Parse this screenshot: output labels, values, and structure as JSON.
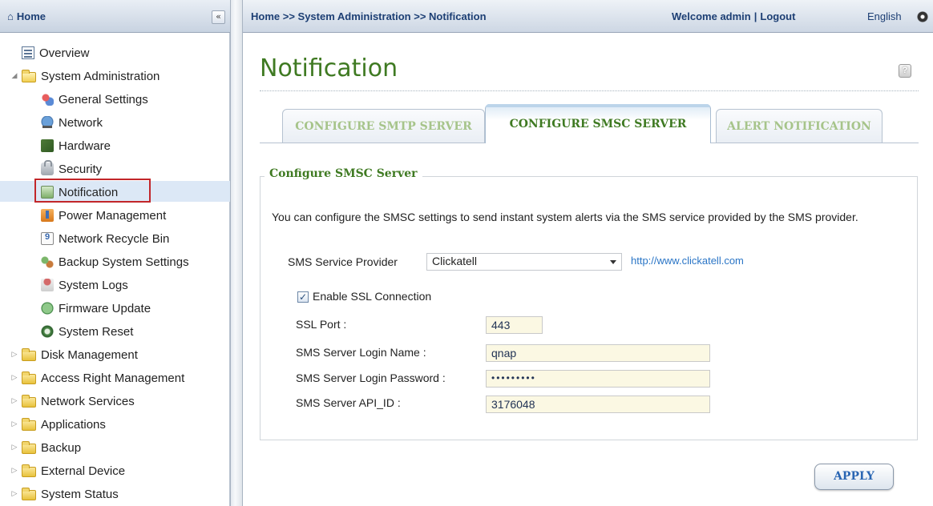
{
  "sidebar": {
    "title": "Home",
    "collapse_label": "«",
    "items": [
      {
        "label": "Overview"
      },
      {
        "label": "System Administration"
      },
      {
        "label": "General Settings"
      },
      {
        "label": "Network"
      },
      {
        "label": "Hardware"
      },
      {
        "label": "Security"
      },
      {
        "label": "Notification"
      },
      {
        "label": "Power Management"
      },
      {
        "label": "Network Recycle Bin"
      },
      {
        "label": "Backup System Settings"
      },
      {
        "label": "System Logs"
      },
      {
        "label": "Firmware Update"
      },
      {
        "label": "System Reset"
      },
      {
        "label": "Disk Management"
      },
      {
        "label": "Access Right Management"
      },
      {
        "label": "Network Services"
      },
      {
        "label": "Applications"
      },
      {
        "label": "Backup"
      },
      {
        "label": "External Device"
      },
      {
        "label": "System Status"
      }
    ]
  },
  "header": {
    "breadcrumb": "Home >> System Administration >> Notification",
    "welcome": "Welcome admin",
    "separator": "|",
    "logout": "Logout",
    "language": "English"
  },
  "page": {
    "title": "Notification",
    "help": "?"
  },
  "tabs": [
    {
      "label": "CONFIGURE SMTP SERVER"
    },
    {
      "label": "CONFIGURE SMSC SERVER"
    },
    {
      "label": "ALERT NOTIFICATION"
    }
  ],
  "form": {
    "legend": "Configure SMSC Server",
    "description": "You can configure the SMSC settings to send instant system alerts via the SMS service provided by the SMS provider.",
    "provider_label": "SMS Service Provider",
    "provider_value": "Clickatell",
    "provider_link": "http://www.clickatell.com",
    "ssl_checkbox_mark": "✓",
    "ssl_label": "Enable SSL Connection",
    "ssl_port_label": "SSL Port :",
    "ssl_port_value": "443",
    "login_name_label": "SMS Server Login Name :",
    "login_name_value": "qnap",
    "login_password_label": "SMS Server Login Password :",
    "login_password_value": "•••••••••",
    "api_id_label": "SMS Server API_ID :",
    "api_id_value": "3176048",
    "apply_label": "APPLY"
  },
  "colors": {
    "accent_green": "#3f7a22",
    "link_blue": "#2a75c6",
    "highlight_red": "#c2262a"
  }
}
